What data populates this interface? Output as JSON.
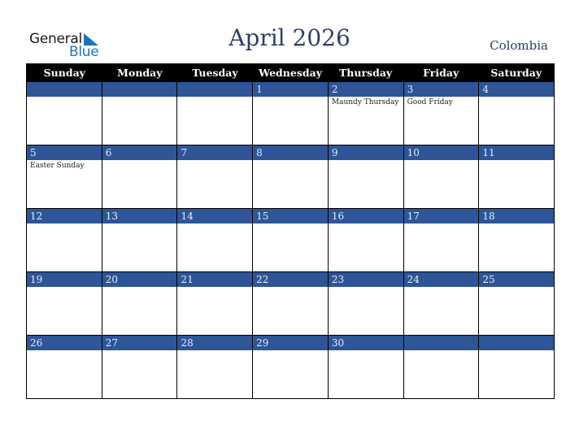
{
  "logo": {
    "text_top": "General",
    "text_bottom": "Blue"
  },
  "title": "April 2026",
  "country": "Colombia",
  "colors": {
    "band": "#2d5597",
    "header": "#000000",
    "title": "#2b3f6b",
    "logo_blue": "#1e73be"
  },
  "weekdays": [
    "Sunday",
    "Monday",
    "Tuesday",
    "Wednesday",
    "Thursday",
    "Friday",
    "Saturday"
  ],
  "weeks": [
    [
      {
        "day": ""
      },
      {
        "day": ""
      },
      {
        "day": ""
      },
      {
        "day": "1"
      },
      {
        "day": "2",
        "event": "Maundy Thursday"
      },
      {
        "day": "3",
        "event": "Good Friday"
      },
      {
        "day": "4"
      }
    ],
    [
      {
        "day": "5",
        "event": "Easter Sunday"
      },
      {
        "day": "6"
      },
      {
        "day": "7"
      },
      {
        "day": "8"
      },
      {
        "day": "9"
      },
      {
        "day": "10"
      },
      {
        "day": "11"
      }
    ],
    [
      {
        "day": "12"
      },
      {
        "day": "13"
      },
      {
        "day": "14"
      },
      {
        "day": "15"
      },
      {
        "day": "16"
      },
      {
        "day": "17"
      },
      {
        "day": "18"
      }
    ],
    [
      {
        "day": "19"
      },
      {
        "day": "20"
      },
      {
        "day": "21"
      },
      {
        "day": "22"
      },
      {
        "day": "23"
      },
      {
        "day": "24"
      },
      {
        "day": "25"
      }
    ],
    [
      {
        "day": "26"
      },
      {
        "day": "27"
      },
      {
        "day": "28"
      },
      {
        "day": "29"
      },
      {
        "day": "30"
      },
      {
        "day": ""
      },
      {
        "day": ""
      }
    ]
  ]
}
